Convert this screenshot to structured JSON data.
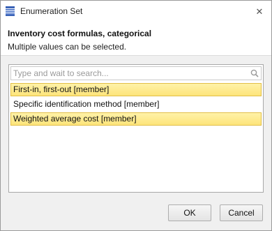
{
  "window": {
    "title": "Enumeration Set",
    "close_label": "✕",
    "icon": "list-icon"
  },
  "header": {
    "heading": "Inventory cost formulas, categorical",
    "subheading": "Multiple values can be selected."
  },
  "search": {
    "value": "",
    "placeholder": "Type and wait to search...",
    "icon": "search-icon"
  },
  "list": {
    "items": [
      {
        "label": "First-in, first-out [member]",
        "selected": true
      },
      {
        "label": "Specific identification method [member]",
        "selected": false
      },
      {
        "label": "Weighted average cost [member]",
        "selected": true
      }
    ]
  },
  "footer": {
    "ok_label": "OK",
    "cancel_label": "Cancel"
  },
  "colors": {
    "selection_fill": "#fde47a",
    "selection_border": "#e2bf46",
    "title_icon": "#3a62b6"
  }
}
